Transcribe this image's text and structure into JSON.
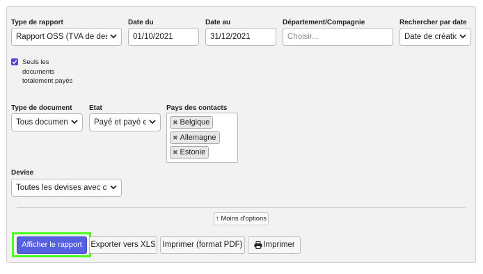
{
  "filters": {
    "report_type": {
      "label": "Type de rapport",
      "value": "Rapport OSS (TVA de destination)"
    },
    "date_from": {
      "label": "Date du",
      "value": "01/10/2021"
    },
    "date_to": {
      "label": "Date au",
      "value": "31/12/2021"
    },
    "department": {
      "label": "Département/Compagnie",
      "placeholder": "Choisir..."
    },
    "search_by_date": {
      "label": "Rechercher par date",
      "value": "Date de création"
    },
    "paid_only": {
      "checked": true,
      "label_lines": [
        "Seuls les",
        "documents",
        "totalement payés"
      ]
    },
    "document_type": {
      "label": "Type de document",
      "value": "Tous documents"
    },
    "state": {
      "label": "Etat",
      "value": "Payé et payé en partie"
    },
    "contact_countries": {
      "label": "Pays des contacts",
      "tags": [
        "Belgique",
        "Allemagne",
        "Estonie"
      ]
    },
    "currency": {
      "label": "Devise",
      "value": "Toutes les devises avec conversion"
    }
  },
  "less_options_label": "↑ Moins d'options",
  "actions": {
    "show_report": "Afficher le rapport",
    "export_xls": "Exporter vers XLS",
    "print_pdf": "Imprimer (format PDF)",
    "print": "Imprimer"
  },
  "colors": {
    "primary_button": "#5561e0",
    "highlight": "#4cff1a",
    "checkbox": "#5b3fd6"
  }
}
